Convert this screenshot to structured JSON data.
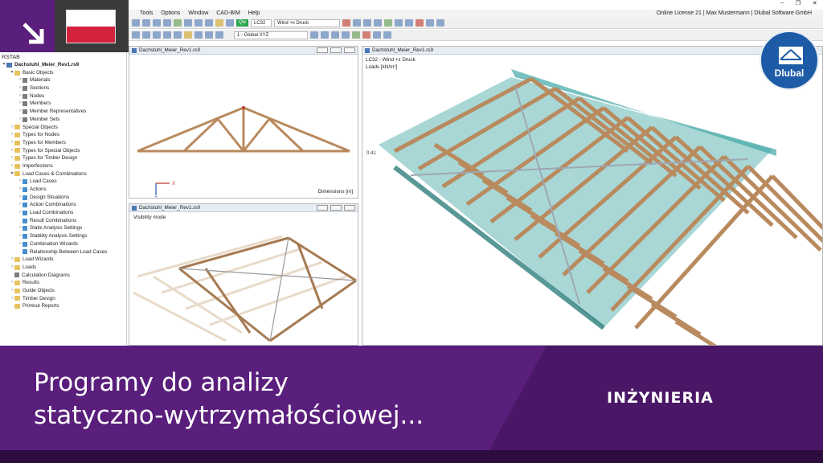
{
  "language_flag": "poland",
  "app": {
    "menu": [
      "Tools",
      "Options",
      "Window",
      "CAD-BIM",
      "Help"
    ],
    "license_text": "Online License 21 | Max Mustermann | Dlubal Software GmbH",
    "window_controls": [
      "–",
      "❐",
      "✕"
    ]
  },
  "toolbar": {
    "load_case_badge": "Qw",
    "load_case_id": "LC32",
    "load_case_name": "Wind +x Druck",
    "coord_system": "1 - Global XYZ"
  },
  "navigator": {
    "title": "RSTAB",
    "items": [
      {
        "label": "Dachstuhl_Meier_Rev1.rs9",
        "level": 0,
        "icon": "file",
        "twisty": "▾",
        "bold": true
      },
      {
        "label": "Basic Objects",
        "level": 1,
        "icon": "folder",
        "twisty": "▾"
      },
      {
        "label": "Materials",
        "level": 2,
        "icon": "obj",
        "twisty": "›"
      },
      {
        "label": "Sections",
        "level": 2,
        "icon": "obj",
        "twisty": "›"
      },
      {
        "label": "Nodes",
        "level": 2,
        "icon": "obj",
        "twisty": "›"
      },
      {
        "label": "Members",
        "level": 2,
        "icon": "obj",
        "twisty": "›"
      },
      {
        "label": "Member Representatives",
        "level": 2,
        "icon": "obj",
        "twisty": "›"
      },
      {
        "label": "Member Sets",
        "level": 2,
        "icon": "obj",
        "twisty": "›"
      },
      {
        "label": "Special Objects",
        "level": 1,
        "icon": "folder",
        "twisty": "›"
      },
      {
        "label": "Types for Nodes",
        "level": 1,
        "icon": "folder",
        "twisty": "›"
      },
      {
        "label": "Types for Members",
        "level": 1,
        "icon": "folder",
        "twisty": "›"
      },
      {
        "label": "Types for Special Objects",
        "level": 1,
        "icon": "folder",
        "twisty": "›"
      },
      {
        "label": "Types for Timber Design",
        "level": 1,
        "icon": "folder",
        "twisty": "›"
      },
      {
        "label": "Imperfections",
        "level": 1,
        "icon": "folder",
        "twisty": "›"
      },
      {
        "label": "Load Cases & Combinations",
        "level": 1,
        "icon": "folder",
        "twisty": "▾"
      },
      {
        "label": "Load Cases",
        "level": 2,
        "icon": "lc",
        "twisty": "›"
      },
      {
        "label": "Actions",
        "level": 2,
        "icon": "lc",
        "twisty": "›"
      },
      {
        "label": "Design Situations",
        "level": 2,
        "icon": "lc",
        "twisty": "›"
      },
      {
        "label": "Action Combinations",
        "level": 2,
        "icon": "lc",
        "twisty": "›"
      },
      {
        "label": "Load Combinations",
        "level": 2,
        "icon": "lc",
        "twisty": "›"
      },
      {
        "label": "Result Combinations",
        "level": 2,
        "icon": "lc",
        "twisty": ""
      },
      {
        "label": "Static Analysis Settings",
        "level": 2,
        "icon": "lc",
        "twisty": "›"
      },
      {
        "label": "Stability Analysis Settings",
        "level": 2,
        "icon": "lc",
        "twisty": "›"
      },
      {
        "label": "Combination Wizards",
        "level": 2,
        "icon": "lc",
        "twisty": "›"
      },
      {
        "label": "Relationship Between Load Cases",
        "level": 2,
        "icon": "lc",
        "twisty": ""
      },
      {
        "label": "Load Wizards",
        "level": 1,
        "icon": "folder",
        "twisty": "›"
      },
      {
        "label": "Loads",
        "level": 1,
        "icon": "folder",
        "twisty": "›"
      },
      {
        "label": "Calculation Diagrams",
        "level": 1,
        "icon": "obj",
        "twisty": ""
      },
      {
        "label": "Results",
        "level": 1,
        "icon": "folder",
        "twisty": "›"
      },
      {
        "label": "Guide Objects",
        "level": 1,
        "icon": "folder",
        "twisty": "›"
      },
      {
        "label": "Timber Design",
        "level": 1,
        "icon": "folder",
        "twisty": "›"
      },
      {
        "label": "Printout Reports",
        "level": 1,
        "icon": "folder",
        "twisty": ""
      }
    ]
  },
  "views": {
    "top_left": {
      "title": "Dachstuhl_Meier_Rev1.rs9",
      "note": "Dimensions [m]",
      "axis_x": "X",
      "axis_z": "Z"
    },
    "bottom_left": {
      "title": "Dachstuhl_Meier_Rev1.rs9",
      "note": "Visibility mode"
    },
    "main": {
      "title": "Dachstuhl_Meier_Rev1.rs9",
      "lc_line": "LC32 - Wind +x Druck",
      "units_line": "Loads [kN/m²]",
      "load_value": "0.41"
    }
  },
  "banner": {
    "title_line1": "Programy do analizy",
    "title_line2": "statyczno-wytrzymałościowej...",
    "category": "INŻYNIERIA"
  },
  "brand": {
    "name": "Dlubal"
  },
  "colors": {
    "accent_purple": "#5a1e7c",
    "timber": "#b98a5e",
    "wind_load": "#3fa7a5",
    "brand_blue": "#1d5ba7"
  }
}
